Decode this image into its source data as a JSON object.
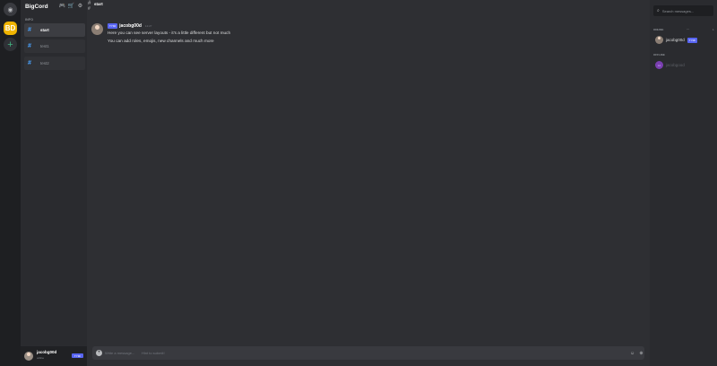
{
  "servers": [
    {
      "name": "home",
      "icon": "discord-icon"
    },
    {
      "name": "BigCord",
      "label": "BD",
      "color": "#f0b400"
    },
    {
      "name": "add-server",
      "label": "+",
      "color": "#43b581"
    }
  ],
  "sidebar": {
    "guild_name": "BigCord",
    "icons": [
      "controller-icon",
      "shop-icon",
      "gear-icon"
    ],
    "category": "INFO",
    "channels": [
      {
        "label": "start",
        "active": true
      },
      {
        "label": "test1",
        "active": false
      },
      {
        "label": "test2",
        "active": false
      }
    ],
    "user": {
      "name": "jacobg00d",
      "status": "online",
      "badge": "TYMI"
    }
  },
  "header": {
    "hash": "#",
    "channel": "start",
    "sub": "#"
  },
  "message": {
    "badge": "TYMI",
    "author": "jacobg00d",
    "time": "12:27",
    "lines": [
      "Here you can see server layouts - it's a little different but not much",
      "You can add roles, emojis, new channels and much more"
    ]
  },
  "composer": {
    "placeholder": "Write a message...",
    "hint": "Hint to submit!"
  },
  "right_panel": {
    "search_placeholder": "Search messages...",
    "online_label": "ONLINE",
    "online_count": "1",
    "online_dash": "—",
    "offline_label": "OFFLINE",
    "members_online": [
      {
        "name": "jacobg00d",
        "badge": "TYMI"
      }
    ],
    "members_offline": [
      {
        "name": "jacobgood",
        "initials": "JA"
      }
    ]
  },
  "colors": {
    "accent": "#5865f2",
    "channel_hash": "#4aa3ff",
    "background": "#2e2f33"
  }
}
